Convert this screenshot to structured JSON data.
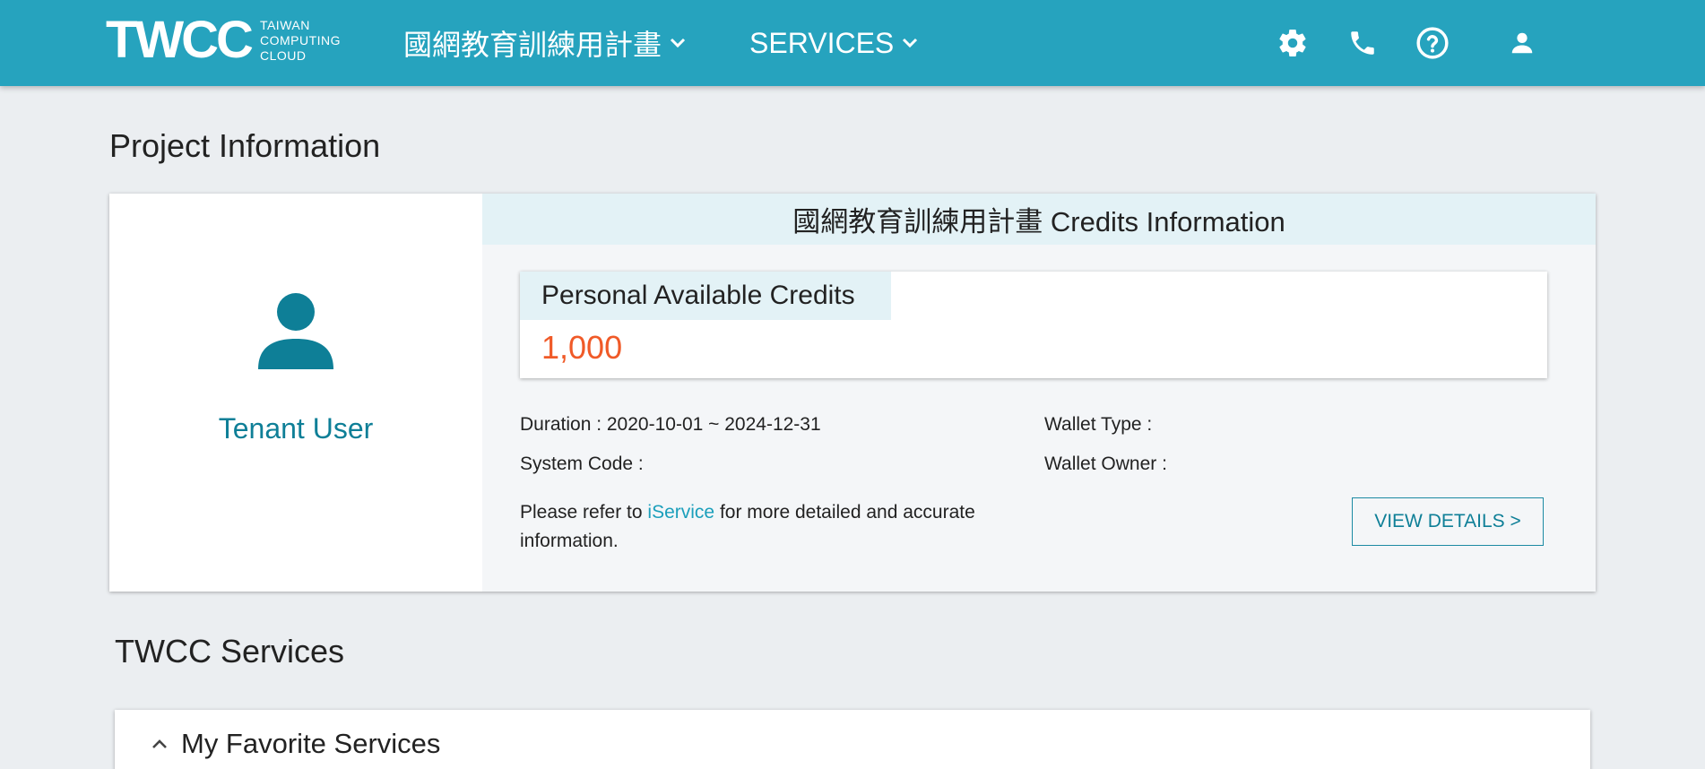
{
  "header": {
    "logo_mark": "TWCC",
    "logo_line1": "TAIWAN",
    "logo_line2": "COMPUTING",
    "logo_line3": "CLOUD",
    "project_menu_label": "國網教育訓練用計畫",
    "services_menu_label": "SERVICES",
    "icons": [
      "gear-icon",
      "phone-icon",
      "help-icon",
      "user-icon"
    ]
  },
  "project_section": {
    "title": "Project Information",
    "tenant_name": "Tenant User",
    "credits_header": "國網教育訓練用計畫 Credits Information",
    "credits_label": "Personal Available Credits",
    "credits_value": "1,000",
    "duration": "Duration : 2020-10-01 ~ 2024-12-31",
    "system_code": "System Code :",
    "wallet_type": "Wallet Type :",
    "wallet_owner": "Wallet Owner :",
    "refer_prefix": "Please refer to ",
    "refer_link": "iService",
    "refer_suffix": " for more detailed and accurate information.",
    "view_details": "VIEW DETAILS >"
  },
  "services_section": {
    "title": "TWCC Services",
    "favorites_label": "My Favorite Services"
  },
  "colors": {
    "brand": "#26a3be",
    "accent_text": "#0e7f97",
    "credits_value": "#f05a28",
    "page_bg": "#ebeef1"
  }
}
